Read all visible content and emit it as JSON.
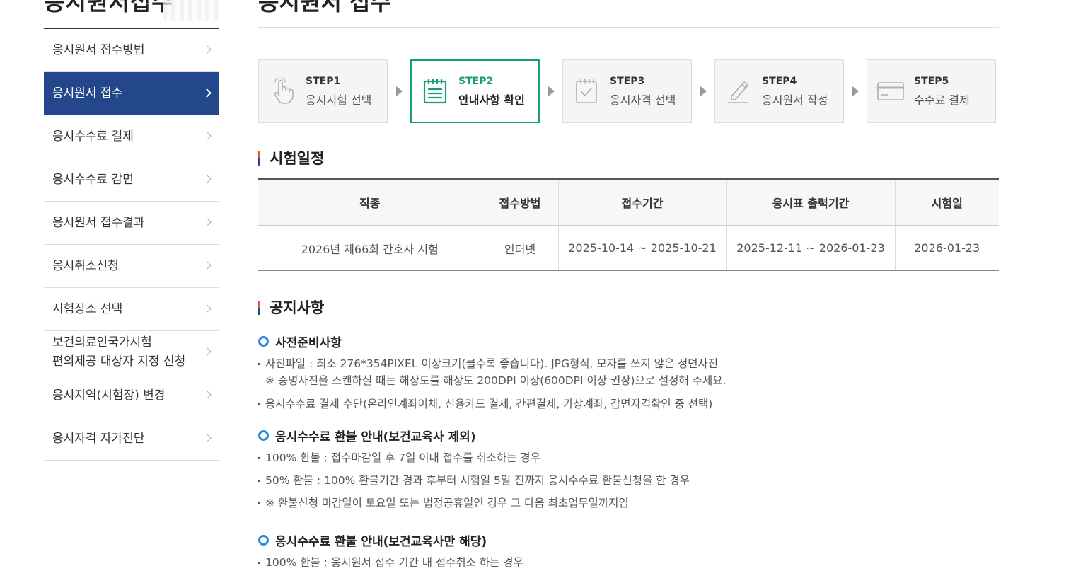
{
  "header": {
    "left_title": "응시원서접수",
    "right_title": "응시원서 접수"
  },
  "sidebar": {
    "items": [
      {
        "label": "응시원서 접수방법"
      },
      {
        "label": "응시원서 접수"
      },
      {
        "label": "응시수수료 결제"
      },
      {
        "label": "응시수수료 감면"
      },
      {
        "label": "응시원서 접수결과"
      },
      {
        "label": "응시취소신청"
      },
      {
        "label": "시험장소 선택"
      },
      {
        "label": "보건의료인국가시험\n편의제공 대상자 지정 신청"
      },
      {
        "label": "응시지역(시험장) 변경"
      },
      {
        "label": "응시자격 자가진단"
      }
    ],
    "active_index": 1
  },
  "steps": [
    {
      "num": "STEP1",
      "name": "응시시험 선택",
      "icon": "hand-pointer-icon"
    },
    {
      "num": "STEP2",
      "name": "안내사항 확인",
      "icon": "notice-list-icon"
    },
    {
      "num": "STEP3",
      "name": "응시자격 선택",
      "icon": "checklist-icon"
    },
    {
      "num": "STEP4",
      "name": "응시원서 작성",
      "icon": "pencil-icon"
    },
    {
      "num": "STEP5",
      "name": "수수료 결제",
      "icon": "credit-card-icon"
    }
  ],
  "schedule": {
    "title": "시험일정",
    "headers": [
      "직종",
      "접수방법",
      "접수기간",
      "응시표 출력기간",
      "시험일"
    ],
    "row": [
      "2026년 제66회 간호사 시험",
      "인터넷",
      "2025-10-14 ~ 2025-10-21",
      "2025-12-11 ~ 2026-01-23",
      "2026-01-23"
    ]
  },
  "notice": {
    "title": "공지사항",
    "prep": {
      "title": "사전준비사항",
      "line1": "사진파일 : 최소 276*354PIXEL 이상크기(클수록 좋습니다). JPG형식, 모자를 쓰지 않은 정면사진",
      "line1_note": "※ 증명사진을 스캔하실 때는 해상도를 해상도 200DPI 이상(600DPI 이상 권장)으로 설정해 주세요.",
      "line2": "응시수수료 결제 수단(온라인계좌이체, 신용카드 결제, 간편결제, 가상계좌, 감면자격확인 중 선택)"
    },
    "refund1": {
      "title": "응시수수료 환불 안내(보건교육사 제외)",
      "line1": "100% 환불 : 접수마감일 후 7일 이내 접수를 취소하는 경우",
      "line2": "50% 환불 : 100% 환불기간 경과 후부터 시험일 5일 전까지 응시수수료 환불신청을 한 경우",
      "line3": "※ 환불신청 마감일이 토요일 또는 법정공휴일인 경우 그 다음 최초업무일까지임"
    },
    "refund2": {
      "title": "응시수수료 환불 안내(보건교육사만 해당)",
      "line1": "100% 환불 : 응시원서 접수 기간 내 접수취소 하는 경우"
    }
  },
  "colors": {
    "sidebar_active": "#23478a",
    "step_active": "#1a9b7e",
    "bullet_circle": "#2a87e2"
  }
}
